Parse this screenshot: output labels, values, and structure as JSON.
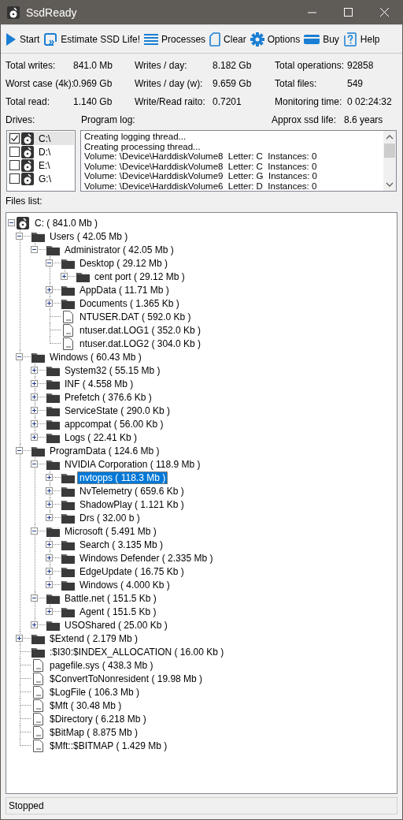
{
  "window": {
    "title": "SsdReady"
  },
  "toolbar": [
    {
      "label": "Start"
    },
    {
      "label": "Estimate SSD Life!"
    },
    {
      "label": "Processes"
    },
    {
      "label": "Clear"
    },
    {
      "label": "Options"
    },
    {
      "label": "Buy"
    },
    {
      "label": "Help"
    }
  ],
  "stats": [
    {
      "label": "Total writes:",
      "value": "841.0 Mb"
    },
    {
      "label": "Writes / day:",
      "value": "8.182 Gb"
    },
    {
      "label": "Total operations:",
      "value": "92858"
    },
    {
      "label": "Worst case (4k):",
      "value": "0.969 Gb"
    },
    {
      "label": "Writes / day (w):",
      "value": "9.659 Gb"
    },
    {
      "label": "Total files:",
      "value": "549"
    },
    {
      "label": "Total read:",
      "value": "1.140 Gb"
    },
    {
      "label": "Write/Read raito:",
      "value": "0.7201"
    },
    {
      "label": "Monitoring time:",
      "value": "0 02:24:32"
    }
  ],
  "drives_label": "Drives:",
  "log_label": "Program log:",
  "ssd_life": {
    "label": "Approx ssd life:",
    "value": "8.6 years"
  },
  "drives": [
    {
      "label": "C:\\",
      "checked": true,
      "selected": true
    },
    {
      "label": "D:\\",
      "checked": false,
      "selected": false
    },
    {
      "label": "E:\\",
      "checked": false,
      "selected": false
    },
    {
      "label": "G:\\",
      "checked": false,
      "selected": false
    }
  ],
  "log": [
    "Creating logging thread...",
    "Creating processing thread...",
    "Volume: \\Device\\HarddiskVolume8  Letter: C  Instances: 0",
    "Volume: \\Device\\HarddiskVolume8  Letter: C  Instances: 0",
    "Volume: \\Device\\HarddiskVolume9  Letter: G  Instances: 0",
    "Volume: \\Device\\HarddiskVolume6  Letter: D  Instances: 0"
  ],
  "files_label": "Files list:",
  "tree": [
    {
      "kind": "drive",
      "label": "C: ( 841.0 Mb )",
      "expanded": true,
      "selected": false,
      "children": [
        {
          "kind": "folder",
          "label": "Users ( 42.05 Mb )",
          "expanded": true,
          "selected": false,
          "children": [
            {
              "kind": "folder",
              "label": "Administrator ( 42.05 Mb )",
              "expanded": true,
              "selected": false,
              "children": [
                {
                  "kind": "folder",
                  "label": "Desktop ( 29.12 Mb )",
                  "expanded": true,
                  "selected": false,
                  "children": [
                    {
                      "kind": "folder",
                      "label": "cent port ( 29.12 Mb )",
                      "expanded": false,
                      "selected": false
                    }
                  ]
                },
                {
                  "kind": "folder",
                  "label": "AppData ( 11.71 Mb )",
                  "expanded": false,
                  "selected": false
                },
                {
                  "kind": "folder",
                  "label": "Documents ( 1.365 Kb )",
                  "expanded": false,
                  "selected": false
                },
                {
                  "kind": "file",
                  "label": "NTUSER.DAT ( 592.0 Kb )",
                  "selected": false
                },
                {
                  "kind": "file",
                  "label": "ntuser.dat.LOG1 ( 352.0 Kb )",
                  "selected": false
                },
                {
                  "kind": "file",
                  "label": "ntuser.dat.LOG2 ( 304.0 Kb )",
                  "selected": false
                }
              ]
            }
          ]
        },
        {
          "kind": "folder",
          "label": "Windows ( 60.43 Mb )",
          "expanded": true,
          "selected": false,
          "children": [
            {
              "kind": "folder",
              "label": "System32 ( 55.15 Mb )",
              "expanded": false,
              "selected": false
            },
            {
              "kind": "folder",
              "label": "INF ( 4.558 Mb )",
              "expanded": false,
              "selected": false
            },
            {
              "kind": "folder",
              "label": "Prefetch ( 376.6 Kb )",
              "expanded": false,
              "selected": false
            },
            {
              "kind": "folder",
              "label": "ServiceState ( 290.0 Kb )",
              "expanded": false,
              "selected": false
            },
            {
              "kind": "folder",
              "label": "appcompat ( 56.00 Kb )",
              "expanded": false,
              "selected": false
            },
            {
              "kind": "folder",
              "label": "Logs ( 22.41 Kb )",
              "expanded": false,
              "selected": false
            }
          ]
        },
        {
          "kind": "folder",
          "label": "ProgramData ( 124.6 Mb )",
          "expanded": true,
          "selected": false,
          "children": [
            {
              "kind": "folder",
              "label": "NVIDIA Corporation ( 118.9 Mb )",
              "expanded": true,
              "selected": false,
              "children": [
                {
                  "kind": "folder",
                  "label": "nvtopps ( 118.3 Mb )",
                  "expanded": false,
                  "selected": true
                },
                {
                  "kind": "folder",
                  "label": "NvTelemetry ( 659.6 Kb )",
                  "expanded": false,
                  "selected": false
                },
                {
                  "kind": "folder",
                  "label": "ShadowPlay ( 1.121 Kb )",
                  "expanded": false,
                  "selected": false
                },
                {
                  "kind": "folder",
                  "label": "Drs ( 32.00 b )",
                  "expanded": false,
                  "selected": false
                }
              ]
            },
            {
              "kind": "folder",
              "label": "Microsoft ( 5.491 Mb )",
              "expanded": true,
              "selected": false,
              "children": [
                {
                  "kind": "folder",
                  "label": "Search ( 3.135 Mb )",
                  "expanded": false,
                  "selected": false
                },
                {
                  "kind": "folder",
                  "label": "Windows Defender ( 2.335 Mb )",
                  "expanded": false,
                  "selected": false
                },
                {
                  "kind": "folder",
                  "label": "EdgeUpdate ( 16.75 Kb )",
                  "expanded": false,
                  "selected": false
                },
                {
                  "kind": "folder",
                  "label": "Windows ( 4.000 Kb )",
                  "expanded": false,
                  "selected": false
                }
              ]
            },
            {
              "kind": "folder",
              "label": "Battle.net ( 151.5 Kb )",
              "expanded": true,
              "selected": false,
              "children": [
                {
                  "kind": "folder",
                  "label": "Agent ( 151.5 Kb )",
                  "expanded": false,
                  "selected": false
                }
              ]
            },
            {
              "kind": "folder",
              "label": "USOShared ( 25.00 Kb )",
              "expanded": false,
              "selected": false
            }
          ]
        },
        {
          "kind": "folder",
          "label": "$Extend ( 2.179 Mb )",
          "expanded": false,
          "selected": false
        },
        {
          "kind": "folder",
          "label": ":$I30:$INDEX_ALLOCATION ( 16.00 Kb )",
          "selected": false
        },
        {
          "kind": "file",
          "label": "pagefile.sys ( 438.3 Mb )",
          "selected": false
        },
        {
          "kind": "file",
          "label": "$ConvertToNonresident ( 19.98 Mb )",
          "selected": false
        },
        {
          "kind": "file",
          "label": "$LogFile ( 106.3 Mb )",
          "selected": false
        },
        {
          "kind": "file",
          "label": "$Mft ( 30.48 Mb )",
          "selected": false
        },
        {
          "kind": "file",
          "label": "$Directory ( 6.218 Mb )",
          "selected": false
        },
        {
          "kind": "file",
          "label": "$BitMap ( 8.875 Mb )",
          "selected": false
        },
        {
          "kind": "file",
          "label": "$Mft::$BITMAP ( 1.429 Mb )",
          "selected": false
        }
      ]
    }
  ],
  "status_bar": "Stopped"
}
